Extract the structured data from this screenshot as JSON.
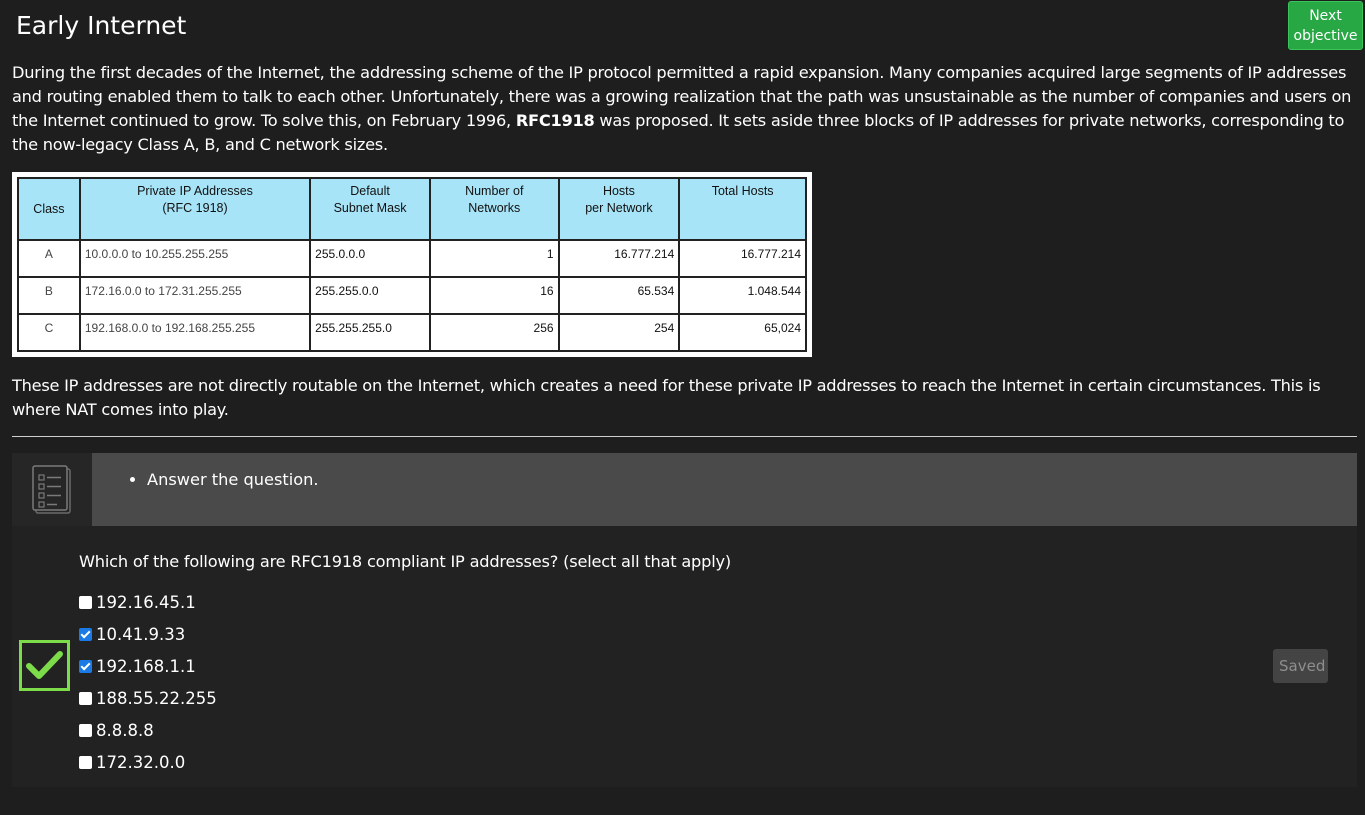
{
  "header": {
    "title": "Early Internet",
    "next_button": "Next objective"
  },
  "intro": {
    "part1": "During the first decades of the Internet, the addressing scheme of the IP protocol permitted a rapid expansion. Many companies acquired large segments of IP addresses and routing enabled them to talk to each other. Unfortunately, there was a growing realization that the path was unsustainable as the number of companies and users on the Internet continued to grow. To solve this, on February 1996, ",
    "bold": "RFC1918",
    "part2": " was proposed. It sets aside three blocks of IP addresses for private networks, corresponding to the now-legacy Class A, B, and C network sizes."
  },
  "table": {
    "headers": {
      "class": "Class",
      "private_line1": "Private IP Addresses",
      "private_line2": "(RFC 1918)",
      "mask_line1": "Default",
      "mask_line2": "Subnet Mask",
      "networks_line1": "Number of",
      "networks_line2": "Networks",
      "hosts_line1": "Hosts",
      "hosts_line2": "per Network",
      "total": "Total Hosts"
    },
    "rows": [
      {
        "class": "A",
        "range": "10.0.0.0 to 10.255.255.255",
        "mask": "255.0.0.0",
        "networks": "1",
        "hosts": "16.777.214",
        "total": "16.777.214"
      },
      {
        "class": "B",
        "range": "172.16.0.0 to 172.31.255.255",
        "mask": "255.255.0.0",
        "networks": "16",
        "hosts": "65.534",
        "total": "1.048.544"
      },
      {
        "class": "C",
        "range": "192.168.0.0 to 192.168.255.255",
        "mask": "255.255.255.0",
        "networks": "256",
        "hosts": "254",
        "total": "65,024"
      }
    ]
  },
  "para2": "These IP addresses are not directly routable on the Internet, which creates a need for these private IP addresses to reach the Internet in certain circumstances. This is where NAT comes into play.",
  "instructions": {
    "icon": "checklist-icon",
    "items": [
      "Answer the question."
    ]
  },
  "question": {
    "text": "Which of the following are RFC1918 compliant IP addresses? (select all that apply)",
    "options": [
      {
        "label": "192.16.45.1",
        "checked": false
      },
      {
        "label": "10.41.9.33",
        "checked": true
      },
      {
        "label": "192.168.1.1",
        "checked": true
      },
      {
        "label": "188.55.22.255",
        "checked": false
      },
      {
        "label": "8.8.8.8",
        "checked": false
      },
      {
        "label": "172.32.0.0",
        "checked": false
      }
    ],
    "status_icon": "checkmark-icon",
    "status_color": "#7ddc4a",
    "saved_label": "Saved"
  },
  "colors": {
    "background": "#1e1e1e",
    "accent_green": "#28a745",
    "table_header": "#a8e4f7",
    "checkbox_checked": "#1a7ae6"
  }
}
